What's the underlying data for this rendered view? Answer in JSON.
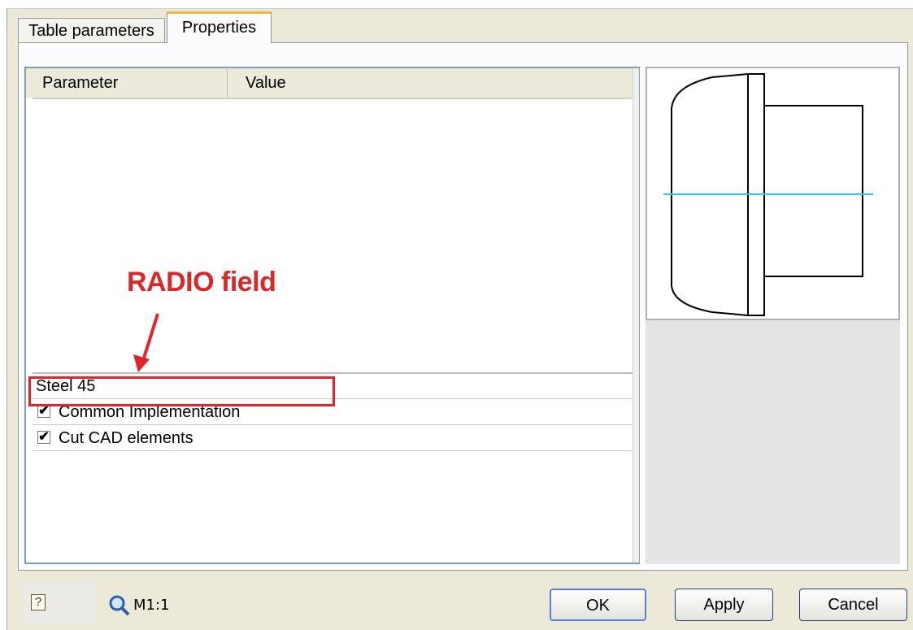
{
  "tabs": [
    {
      "label": "Table parameters",
      "active": false
    },
    {
      "label": "Properties",
      "active": true
    }
  ],
  "grid": {
    "columns": [
      "Parameter",
      "Value"
    ],
    "rows": [
      {
        "type": "text",
        "label": "Steel 45"
      },
      {
        "type": "checkbox",
        "label": "Common Implementation",
        "checked": true
      },
      {
        "type": "checkbox",
        "label": "Cut CAD elements",
        "checked": true
      }
    ]
  },
  "annotation": {
    "label": "RADIO field",
    "color": "#d82828"
  },
  "preview": {
    "outline_color": "#000000",
    "axis_color": "#2ec6e0"
  },
  "footer": {
    "help_icon": "help-icon",
    "zoom_icon": "magnifier-icon",
    "scale": "M1:1",
    "buttons": {
      "ok": "OK",
      "apply": "Apply",
      "cancel": "Cancel"
    }
  },
  "glyphs": {
    "check": "✔",
    "help": "?"
  }
}
